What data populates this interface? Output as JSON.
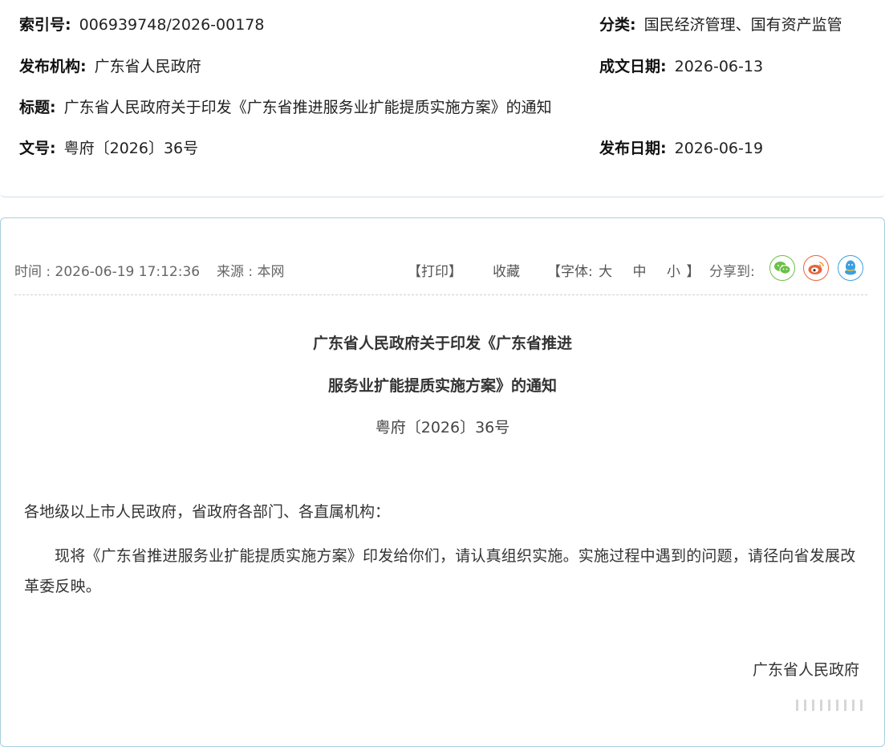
{
  "meta": {
    "index_label": "索引号:",
    "index_value": "006939748/2026-00178",
    "category_label": "分类:",
    "category_value": "国民经济管理、国有资产监管",
    "publisher_label": "发布机构:",
    "publisher_value": "广东省人民政府",
    "written_date_label": "成文日期:",
    "written_date_value": "2026-06-13",
    "title_label": "标题:",
    "title_value": "广东省人民政府关于印发《广东省推进服务业扩能提质实施方案》的通知",
    "doc_no_label": "文号:",
    "doc_no_value": "粤府〔2026〕36号",
    "publish_date_label": "发布日期:",
    "publish_date_value": "2026-06-19"
  },
  "toolbar": {
    "time": "时间 : 2026-06-19 17:12:36",
    "source": "来源 : 本网",
    "print": "【打印】",
    "favorite": "收藏",
    "font_prefix": "【字体:",
    "font_large": "大",
    "font_medium": "中",
    "font_small": "小",
    "font_suffix": "】",
    "share_label": "分享到:",
    "share_icons": [
      "wechat-icon",
      "weibo-icon",
      "qq-icon"
    ],
    "colors": {
      "wechat": "#6cc04a",
      "weibo": "#e8643c",
      "qq": "#3aa0e0"
    }
  },
  "article": {
    "title_line1": "广东省人民政府关于印发《广东省推进",
    "title_line2": "服务业扩能提质实施方案》的通知",
    "doc_no": "粤府〔2026〕36号",
    "salutation": "各地级以上市人民政府，省政府各部门、各直属机构：",
    "paragraph": "现将《广东省推进服务业扩能提质实施方案》印发给你们，请认真组织实施。实施过程中遇到的问题，请径向省发展改革委反映。",
    "signature": "广东省人民政府"
  }
}
